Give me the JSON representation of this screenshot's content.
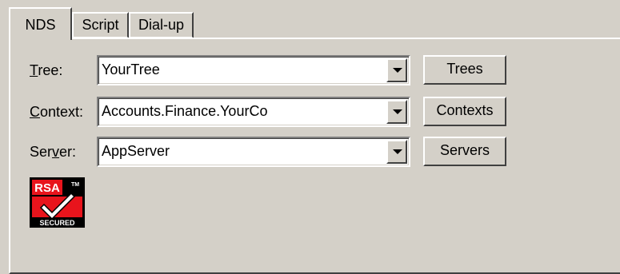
{
  "tabs": [
    {
      "label": "NDS",
      "active": true
    },
    {
      "label": "Script",
      "active": false
    },
    {
      "label": "Dial-up",
      "active": false
    }
  ],
  "fields": {
    "tree": {
      "label_prefix": "",
      "label_accel": "T",
      "label_suffix": "ree:",
      "value": "YourTree",
      "button": "Trees"
    },
    "context": {
      "label_prefix": "",
      "label_accel": "C",
      "label_suffix": "ontext:",
      "value": "Accounts.Finance.YourCo",
      "button": "Contexts"
    },
    "server": {
      "label_prefix": "Ser",
      "label_accel": "v",
      "label_suffix": "er:",
      "value": "AppServer",
      "button": "Servers"
    }
  },
  "logo": {
    "brand": "RSA",
    "tm": "TM",
    "caption": "SECURED",
    "colors": {
      "red": "#e8141c",
      "black": "#000000",
      "white": "#ffffff"
    }
  },
  "colors": {
    "face": "#d4d0c8",
    "highlight": "#ffffff",
    "shadow": "#404040"
  }
}
